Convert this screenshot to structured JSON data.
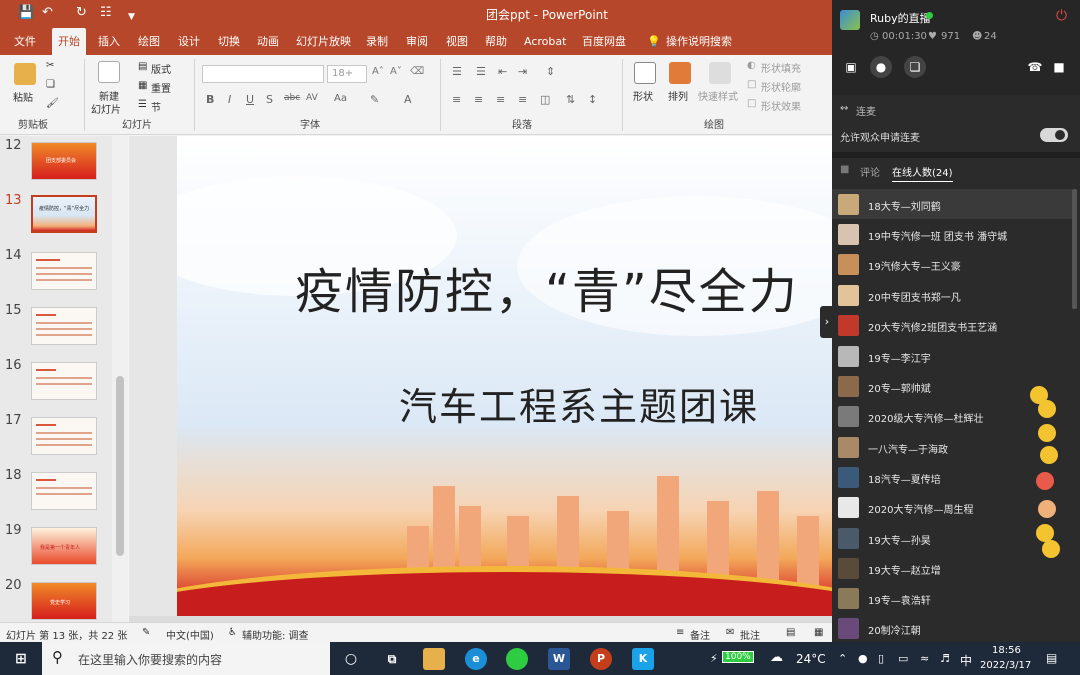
{
  "titlebar": {
    "title": "团会ppt  -  PowerPoint",
    "qa_icons": [
      "save-icon",
      "undo-icon",
      "redo-icon",
      "presenter-icon",
      "customize-icon"
    ]
  },
  "tabs": [
    "文件",
    "开始",
    "插入",
    "绘图",
    "设计",
    "切换",
    "动画",
    "幻灯片放映",
    "录制",
    "审阅",
    "视图",
    "帮助",
    "Acrobat",
    "百度网盘",
    "操作说明搜索"
  ],
  "active_tab": "开始",
  "ribbon": {
    "clipboard": {
      "paste": "粘贴",
      "group": "剪贴板"
    },
    "slides": {
      "new_slide_1": "新建",
      "new_slide_2": "幻灯片",
      "layout": "版式",
      "reset": "重置",
      "section": "节",
      "group": "幻灯片"
    },
    "font": {
      "size": "18+",
      "group": "字体",
      "buttons": [
        "B",
        "I",
        "U",
        "S",
        "abc",
        "AV",
        "Aa",
        "A"
      ]
    },
    "paragraph": {
      "group": "段落"
    },
    "drawing": {
      "shape": "形状",
      "arrange": "排列",
      "quick_style": "快速样式",
      "fill": "形状填充",
      "outline": "形状轮廓",
      "effect": "形状效果",
      "group": "绘图"
    }
  },
  "thumbnails": [
    {
      "num": "12",
      "label": "团支部委员会"
    },
    {
      "num": "13",
      "label": "疫情防控，“青”尽全力",
      "selected": true
    },
    {
      "num": "14",
      "label": ""
    },
    {
      "num": "15",
      "label": ""
    },
    {
      "num": "16",
      "label": ""
    },
    {
      "num": "17",
      "label": ""
    },
    {
      "num": "18",
      "label": ""
    },
    {
      "num": "19",
      "label": "我是第一个青年人"
    },
    {
      "num": "20",
      "label": "党史学习"
    }
  ],
  "slide": {
    "title": "疫情防控，“青”尽全力",
    "subtitle": "汽车工程系主题团课"
  },
  "statusbar": {
    "slide_info": "幻灯片 第 13 张，共 22 张",
    "language": "中文(中国)",
    "accessibility": "辅助功能: 调查",
    "notes": "备注",
    "comments": "批注"
  },
  "live": {
    "host": "Ruby的直播",
    "duration": "00:01:30",
    "likes": "971",
    "viewers": "24",
    "lianmai": "连麦",
    "allow_text": "允许观众申请连麦",
    "tab_comments": "评论",
    "tab_online": "在线人数(24)",
    "users": [
      "18大专—刘同鹤",
      "19中专汽修一班 团支书 潘守城",
      "19汽修大专—王义豪",
      "20中专团支书郑一凡",
      "20大专汽修2班团支书王艺涵",
      "19专—李江宇",
      "20专—郭帅斌",
      "2020级大专汽修—杜辉壮",
      "一八汽专—于海政",
      "18汽专—夏传培",
      "2020大专汽修—周生程",
      "19大专—孙昊",
      "19大专—赵立增",
      "19专—袁浩轩",
      "20制冷江朝"
    ]
  },
  "taskbar": {
    "search_placeholder": "在这里输入你要搜索的内容",
    "battery": "100%",
    "temperature": "24°C",
    "ime": "中",
    "time": "18:56",
    "date": "2022/3/17"
  }
}
